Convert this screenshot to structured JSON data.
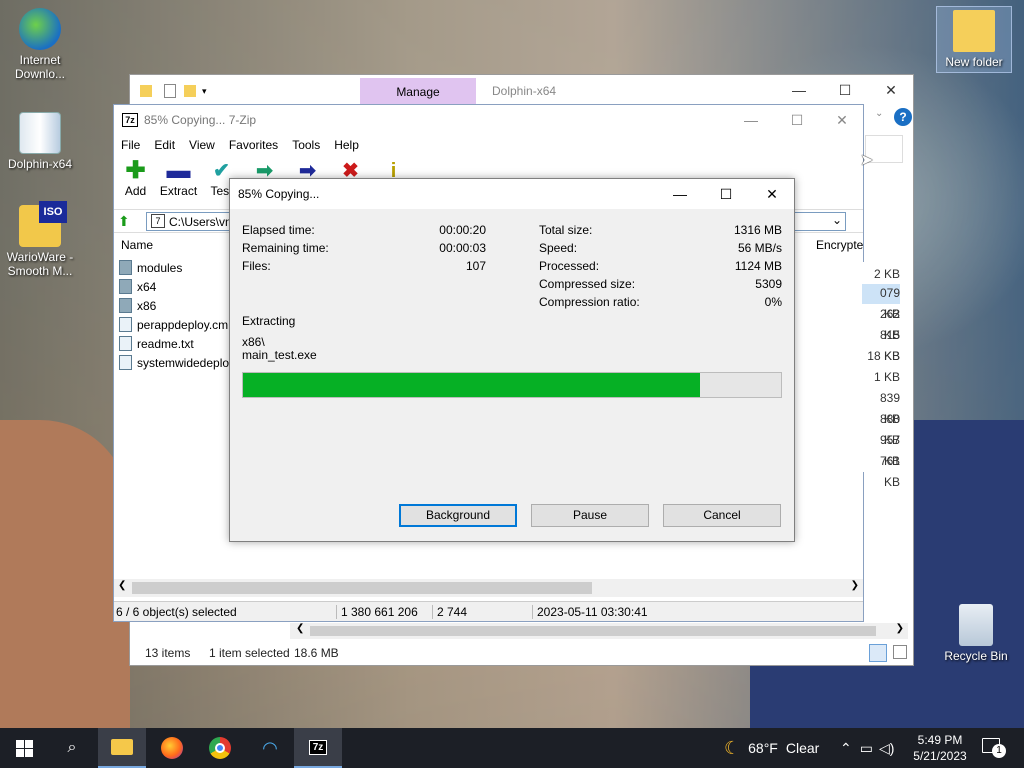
{
  "desktop": {
    "icons": [
      {
        "label": "Internet Downlo..."
      },
      {
        "label": "Dolphin-x64"
      },
      {
        "label": "WarioWare - Smooth M..."
      },
      {
        "label": "New folder"
      },
      {
        "label": "Recycle Bin"
      }
    ]
  },
  "explorer": {
    "manage_tab": "Manage",
    "title": "Dolphin-x64",
    "status_items": "13 items",
    "status_selected": "1 item selected",
    "status_size": "18.6 MB"
  },
  "sevenzip": {
    "title": "85% Copying... 7-Zip",
    "menu": [
      "File",
      "Edit",
      "View",
      "Favorites",
      "Tools",
      "Help"
    ],
    "toolbar": [
      {
        "label": "Add",
        "icon": "add-icon",
        "color": "#1a9b1a"
      },
      {
        "label": "Extract",
        "icon": "extract-icon",
        "color": "#1f2a9a"
      },
      {
        "label": "Test",
        "icon": "test-icon",
        "color": "#20a0a0"
      },
      {
        "label": "",
        "icon": "copy-icon",
        "color": "#1a9b6a"
      },
      {
        "label": "",
        "icon": "move-icon",
        "color": "#1f2a9a"
      },
      {
        "label": "",
        "icon": "delete-icon",
        "color": "#cc1a1a"
      },
      {
        "label": "",
        "icon": "info-icon",
        "color": "#b8a000"
      }
    ],
    "address": "C:\\Users\\vn",
    "columns": {
      "name": "Name",
      "encrypted": "Encrypte"
    },
    "files": [
      {
        "name": "modules",
        "type": "folder"
      },
      {
        "name": "x64",
        "type": "folder"
      },
      {
        "name": "x86",
        "type": "folder"
      },
      {
        "name": "perappdeploy.cm",
        "type": "file"
      },
      {
        "name": "readme.txt",
        "type": "file"
      },
      {
        "name": "systemwidedeploy",
        "type": "file"
      }
    ],
    "sizes": [
      "2 KB",
      "079 KB",
      "262 KB",
      "815 KB",
      "18 KB",
      "1 KB",
      "839 KB",
      "880 KB",
      "957 KB",
      "761 KB"
    ],
    "status": {
      "selected": "6 / 6 object(s) selected",
      "size": "1 380 661 206",
      "packed": "2 744",
      "date": "2023-05-11 03:30:41"
    }
  },
  "progress": {
    "title": "85% Copying...",
    "left": [
      {
        "label": "Elapsed time:",
        "value": "00:00:20"
      },
      {
        "label": "Remaining time:",
        "value": "00:00:03"
      },
      {
        "label": "Files:",
        "value": "107"
      }
    ],
    "right": [
      {
        "label": "Total size:",
        "value": "1316 MB"
      },
      {
        "label": "Speed:",
        "value": "56 MB/s"
      },
      {
        "label": "Processed:",
        "value": "1124 MB"
      },
      {
        "label": "Compressed size:",
        "value": "5309"
      },
      {
        "label": "Compression ratio:",
        "value": "0%"
      }
    ],
    "operation": "Extracting",
    "path_line1": "x86\\",
    "path_line2": "main_test.exe",
    "percent": 85,
    "fill_color": "#06b025",
    "buttons": {
      "background": "Background",
      "pause": "Pause",
      "cancel": "Cancel"
    }
  },
  "taskbar": {
    "weather_temp": "68°F",
    "weather_text": "Clear",
    "time": "5:49 PM",
    "date": "5/21/2023",
    "notification_count": "1"
  }
}
